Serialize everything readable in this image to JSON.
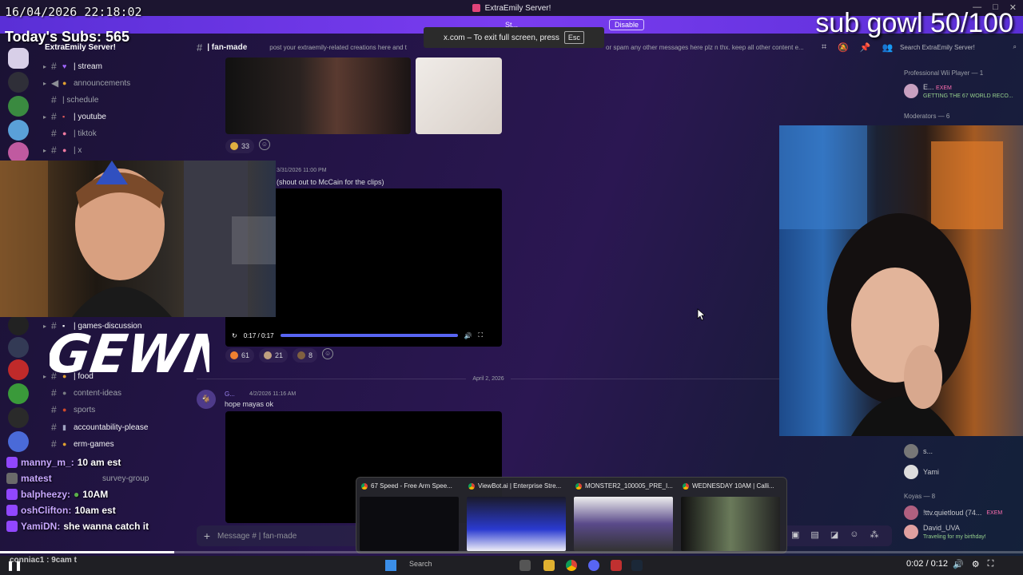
{
  "window": {
    "title": "ExtraEmily Server!",
    "controls": [
      "—",
      "□",
      "✕"
    ]
  },
  "banner": {
    "text": "St...",
    "disable_label": "Disable"
  },
  "overlay": {
    "timestamp": "16/04/2026 22:18:02",
    "todays_subs": "Today's Subs: 565",
    "sub_goal": "sub gowl 50/100",
    "fullscreen_toast": "x.com – To exit full screen, press",
    "fullscreen_key": "Esc"
  },
  "server": {
    "name": "ExtraEmily Server!",
    "channels_top": [
      {
        "name": "| stream",
        "bright": true
      },
      {
        "name": "announcements",
        "bright": false
      },
      {
        "name": "| schedule",
        "bright": false
      },
      {
        "name": "| youtube",
        "bright": true
      },
      {
        "name": "| tiktok",
        "bright": false
      },
      {
        "name": "| x",
        "bright": false
      }
    ],
    "channels_bottom": [
      {
        "name": "| games-discussion",
        "bright": true
      },
      {
        "name": "| food",
        "bright": true
      },
      {
        "name": "content-ideas",
        "bright": false
      },
      {
        "name": "sports",
        "bright": false
      },
      {
        "name": "accountability-please",
        "bright": true
      },
      {
        "name": "erm-games",
        "bright": true
      },
      {
        "name": "survey-group",
        "bright": false
      }
    ]
  },
  "channel_header": {
    "name": "| fan-made",
    "topic": "post your extraemily-related creations here and t",
    "topic_tail": "or spam any other messages here plz n thx. keep all other content e..."
  },
  "search": {
    "placeholder": "Search ExtraEmily Server!"
  },
  "messages": {
    "msg1_reactions": [
      {
        "count": "33"
      }
    ],
    "msg1_time": "3/31/2026 11:00 PM",
    "msg1_text": "(shout out to McCain for the clips)",
    "video_time": "0:17 / 0:17",
    "video_reactions": [
      {
        "count": "61"
      },
      {
        "count": "21"
      },
      {
        "count": "8"
      }
    ],
    "date_divider": "April 2, 2026",
    "msg2_author": "G...",
    "msg2_time": "4/2/2026 11:16 AM",
    "msg2_text": "hope mayas ok"
  },
  "composer": {
    "placeholder": "Message # | fan-made"
  },
  "members": {
    "roles": [
      {
        "title": "Professional Wii Player — 1"
      },
      {
        "title": "Moderators — 6"
      },
      {
        "title": "Koyas — 8"
      }
    ],
    "list": [
      {
        "name": "E...",
        "tag": "EXEM",
        "sub": "GETTING THE 67 WORLD RECO..."
      },
      {
        "name": "s...",
        "tag": "",
        "sub": ""
      },
      {
        "name": "Yami",
        "tag": "",
        "sub": ""
      },
      {
        "name": "!ttv.quietloud (74...",
        "tag": "EXEM",
        "sub": ""
      },
      {
        "name": "David_UVA",
        "tag": "",
        "sub": "Traveling for my birthday!"
      }
    ]
  },
  "stream_chat": [
    {
      "user": "manny_m_:",
      "msg": "10 am est"
    },
    {
      "user": "matest",
      "msg": ""
    },
    {
      "user": "balpheezy:",
      "msg": "10AM"
    },
    {
      "user": "oshClifton:",
      "msg": "10am est"
    },
    {
      "user": "YamiDN:",
      "msg": "she wanna catch it"
    }
  ],
  "bottom_chat": "conniac1 : 9cam t",
  "stream_logo": "GEWN",
  "previews": [
    {
      "title": "67 Speed - Free Arm Spee..."
    },
    {
      "title": "ViewBot.ai | Enterprise Stre..."
    },
    {
      "title": "MONSTER2_100005_PRE_I..."
    },
    {
      "title": "WEDNESDAY 10AM | Calli..."
    }
  ],
  "taskbar": {
    "search": "Search"
  },
  "player": {
    "time": "0:02 / 0:12",
    "progress": 0.17
  }
}
